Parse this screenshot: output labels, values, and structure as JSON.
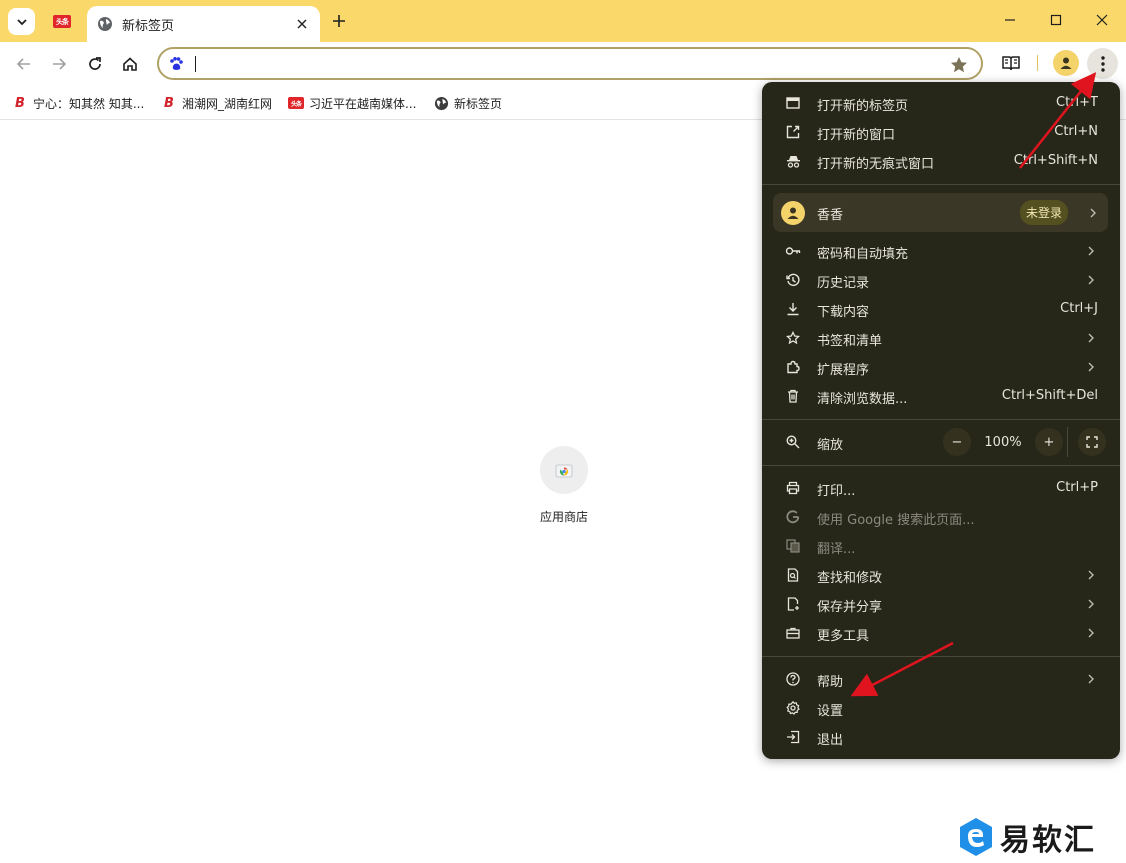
{
  "tabs": {
    "active_title": "新标签页",
    "pinned_icon": "toutiao-logo",
    "pinned_logo_text": "头条"
  },
  "bookmarks": [
    {
      "label": "宁心：知其然 知其..."
    },
    {
      "label": "湘潮网_湖南红网"
    },
    {
      "label": "习近平在越南媒体..."
    },
    {
      "label": "新标签页"
    }
  ],
  "bookmark_icon_text": "B",
  "toolbar": {
    "omnibox_value": ""
  },
  "page": {
    "tile_label": "应用商店"
  },
  "menu": {
    "group1": [
      {
        "label": "打开新的标签页",
        "shortcut": "Ctrl+T",
        "icon": "new-tab-icon"
      },
      {
        "label": "打开新的窗口",
        "shortcut": "Ctrl+N",
        "icon": "new-window-icon"
      },
      {
        "label": "打开新的无痕式窗口",
        "shortcut": "Ctrl+Shift+N",
        "icon": "incognito-icon"
      }
    ],
    "profile": {
      "name": "香香",
      "badge": "未登录"
    },
    "group2": [
      {
        "label": "密码和自动填充",
        "icon": "key-icon"
      },
      {
        "label": "历史记录",
        "icon": "history-icon"
      },
      {
        "label": "下载内容",
        "shortcut": "Ctrl+J",
        "icon": "download-icon"
      },
      {
        "label": "书签和清单",
        "icon": "star-icon"
      },
      {
        "label": "扩展程序",
        "icon": "puzzle-icon"
      },
      {
        "label": "清除浏览数据...",
        "shortcut": "Ctrl+Shift+Del",
        "icon": "trash-icon"
      }
    ],
    "zoom": {
      "label": "缩放",
      "value": "100%",
      "minus": "−",
      "plus": "+"
    },
    "group3": [
      {
        "label": "打印...",
        "shortcut": "Ctrl+P",
        "icon": "print-icon"
      },
      {
        "label": "使用 Google 搜索此页面...",
        "icon": "google-icon"
      },
      {
        "label": "翻译...",
        "icon": "translate-icon"
      },
      {
        "label": "查找和修改",
        "icon": "find-icon"
      },
      {
        "label": "保存并分享",
        "icon": "save-icon"
      },
      {
        "label": "更多工具",
        "icon": "toolbox-icon"
      }
    ],
    "group4": [
      {
        "label": "帮助",
        "icon": "help-icon"
      },
      {
        "label": "设置",
        "icon": "gear-icon"
      },
      {
        "label": "退出",
        "icon": "exit-icon"
      }
    ]
  },
  "watermark": {
    "text": "易软汇"
  },
  "colors": {
    "titlebar": "#fbd86a",
    "menu_bg": "#262619",
    "accent_red": "#e0262b"
  }
}
